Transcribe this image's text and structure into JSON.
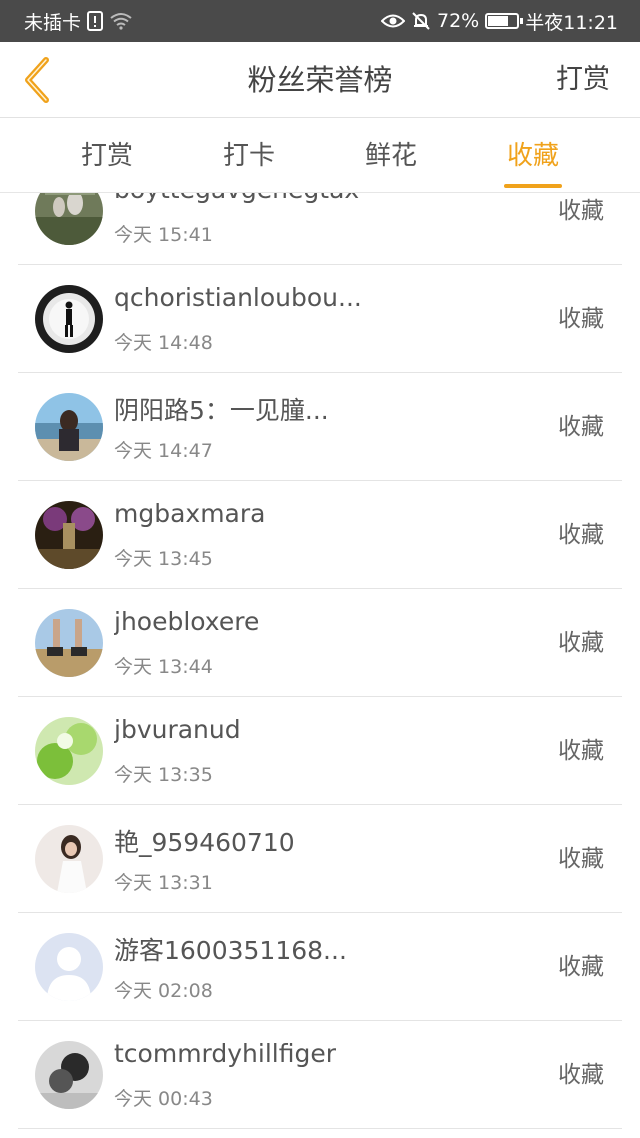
{
  "status_bar": {
    "carrier": "未插卡",
    "battery_percent": "72%",
    "battery_level": 0.72,
    "time": "半夜11:21",
    "icons": [
      "sim-alert-icon",
      "wifi-icon",
      "eye-icon",
      "mute-bell-icon",
      "battery-icon"
    ]
  },
  "header": {
    "back_icon": "chevron-left-icon",
    "title": "粉丝荣誉榜",
    "right_action": "打赏"
  },
  "tabs": [
    {
      "label": "打赏",
      "active": false
    },
    {
      "label": "打卡",
      "active": false
    },
    {
      "label": "鲜花",
      "active": false
    },
    {
      "label": "收藏",
      "active": true
    }
  ],
  "accent_color": "#f0a21b",
  "list": [
    {
      "name": "boyttegavgenegtax",
      "time": "今天 15:41",
      "action": "收藏"
    },
    {
      "name": "qchoristianloubou...",
      "time": "今天 14:48",
      "action": "收藏"
    },
    {
      "name": "阴阳路5：一见朣...",
      "time": "今天 14:47",
      "action": "收藏"
    },
    {
      "name": "mgbaxmara",
      "time": "今天 13:45",
      "action": "收藏"
    },
    {
      "name": "jhoebloxere",
      "time": "今天 13:44",
      "action": "收藏"
    },
    {
      "name": "jbvuranud",
      "time": "今天 13:35",
      "action": "收藏"
    },
    {
      "name": "艳_959460710",
      "time": "今天 13:31",
      "action": "收藏"
    },
    {
      "name": "游客1600351168...",
      "time": "今天 02:08",
      "action": "收藏"
    },
    {
      "name": "tcommrdyhillfiger",
      "time": "今天 00:43",
      "action": "收藏"
    }
  ]
}
